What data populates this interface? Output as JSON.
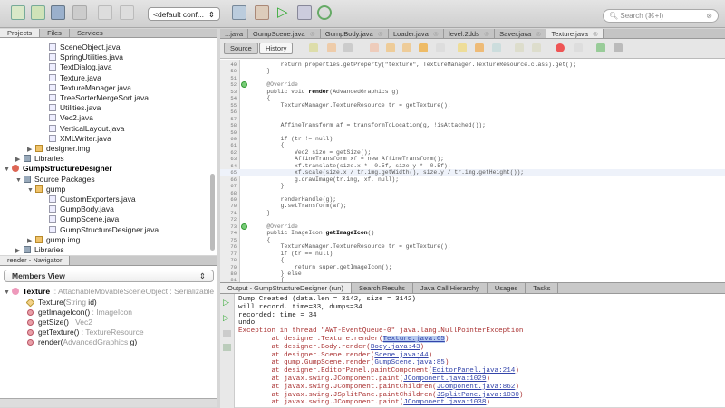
{
  "toolbar": {
    "config": "<default conf...",
    "search_placeholder": "Search (⌘+I)"
  },
  "projects": {
    "tabs": [
      "Projects",
      "Files",
      "Services"
    ],
    "items": [
      {
        "label": "SceneObject.java",
        "type": "java",
        "level": 4
      },
      {
        "label": "SpringUtilities.java",
        "type": "java",
        "level": 4
      },
      {
        "label": "TextDialog.java",
        "type": "java",
        "level": 4
      },
      {
        "label": "Texture.java",
        "type": "java",
        "level": 4
      },
      {
        "label": "TextureManager.java",
        "type": "java",
        "level": 4
      },
      {
        "label": "TreeSorterMergeSort.java",
        "type": "java",
        "level": 4
      },
      {
        "label": "Utilities.java",
        "type": "java",
        "level": 4
      },
      {
        "label": "Vec2.java",
        "type": "java",
        "level": 4
      },
      {
        "label": "VerticalLayout.java",
        "type": "java",
        "level": 4
      },
      {
        "label": "XMLWriter.java",
        "type": "java",
        "level": 4
      },
      {
        "label": "designer.img",
        "type": "pkg",
        "level": 2,
        "arrow": "▶"
      },
      {
        "label": "Libraries",
        "type": "lib",
        "level": 1,
        "arrow": "▶"
      },
      {
        "label": "GumpStructureDesigner",
        "type": "proj",
        "level": 0,
        "arrow": "▼",
        "bold": true
      },
      {
        "label": "Source Packages",
        "type": "lib",
        "level": 1,
        "arrow": "▼"
      },
      {
        "label": "gump",
        "type": "pkg",
        "level": 2,
        "arrow": "▼"
      },
      {
        "label": "CustomExporters.java",
        "type": "java",
        "level": 4
      },
      {
        "label": "GumpBody.java",
        "type": "java",
        "level": 4
      },
      {
        "label": "GumpScene.java",
        "type": "java",
        "level": 4
      },
      {
        "label": "GumpStructureDesigner.java",
        "type": "java",
        "level": 4
      },
      {
        "label": "gump.img",
        "type": "pkg",
        "level": 2,
        "arrow": "▶"
      },
      {
        "label": "Libraries",
        "type": "lib",
        "level": 1,
        "arrow": "▶"
      }
    ]
  },
  "navigator": {
    "title": "render - Navigator",
    "view": "Members View",
    "class_name": "Texture",
    "class_sig": " :: AttachableMovableSceneObject : Serializable",
    "members": [
      {
        "name": "Texture(",
        "args": "String",
        "tail": " id)",
        "ret": ""
      },
      {
        "name": "getImageIcon()",
        "args": "",
        "tail": "",
        "ret": " : ImageIcon"
      },
      {
        "name": "getSize()",
        "args": "",
        "tail": "",
        "ret": " : Vec2"
      },
      {
        "name": "getTexture()",
        "args": "",
        "tail": "",
        "ret": " : TextureResource"
      },
      {
        "name": "render(",
        "args": "AdvancedGraphics",
        "tail": " g)",
        "ret": ""
      }
    ]
  },
  "editor": {
    "tabs": [
      "...java",
      "GumpScene.java",
      "GumpBody.java",
      "Loader.java",
      "level.2dds",
      "Saver.java",
      "Texture.java"
    ],
    "active_tab": "Texture.java",
    "source_label": "Source",
    "history_label": "History",
    "highlight_line": 65,
    "lines": [
      {
        "n": "49",
        "t": "        return properties.getProperty(\"texture\", TextureManager.TextureResource.class).get();"
      },
      {
        "n": "50",
        "t": "    }"
      },
      {
        "n": "51",
        "t": ""
      },
      {
        "n": "52",
        "t": "    @Override"
      },
      {
        "n": "53",
        "t": "    public void ",
        "b": "render",
        "a": "(AdvancedGraphics g)"
      },
      {
        "n": "54",
        "t": "    {"
      },
      {
        "n": "55",
        "t": "        TextureManager.TextureResource tr = getTexture();"
      },
      {
        "n": "56",
        "t": ""
      },
      {
        "n": "57",
        "t": ""
      },
      {
        "n": "58",
        "t": "        AffineTransform af = transformToLocation(g, !isAttached());"
      },
      {
        "n": "59",
        "t": ""
      },
      {
        "n": "60",
        "t": "        if (tr != null)"
      },
      {
        "n": "61",
        "t": "        {"
      },
      {
        "n": "62",
        "t": "            Vec2 size = getSize();"
      },
      {
        "n": "63",
        "t": "            AffineTransform xf = new AffineTransform();"
      },
      {
        "n": "64",
        "t": "            xf.translate(size.x * -0.5f, size.y * -0.5f);"
      },
      {
        "n": "65",
        "t": "            xf.scale(size.x / tr.img.getWidth(), size.y / tr.img.getHeight());"
      },
      {
        "n": "66",
        "t": "            g.drawImage(tr.img, xf, null);"
      },
      {
        "n": "67",
        "t": "        }"
      },
      {
        "n": "68",
        "t": ""
      },
      {
        "n": "69",
        "t": "        renderHandle(g);"
      },
      {
        "n": "70",
        "t": "        g.setTransform(af);"
      },
      {
        "n": "71",
        "t": "    }"
      },
      {
        "n": "72",
        "t": ""
      },
      {
        "n": "73",
        "t": "    @Override"
      },
      {
        "n": "74",
        "t": "    public ImageIcon ",
        "b": "getImageIcon",
        "a": "()"
      },
      {
        "n": "75",
        "t": "    {"
      },
      {
        "n": "76",
        "t": "        TextureManager.TextureResource tr = getTexture();"
      },
      {
        "n": "77",
        "t": "        if (tr == null)"
      },
      {
        "n": "78",
        "t": "        {"
      },
      {
        "n": "79",
        "t": "            return super.getImageIcon();"
      },
      {
        "n": "80",
        "t": "        } else"
      },
      {
        "n": "81",
        "t": "        {"
      }
    ]
  },
  "output": {
    "tabs": [
      "Output - GumpStructureDesigner (run)",
      "Search Results",
      "Java Call Hierarchy",
      "Usages",
      "Tasks"
    ],
    "lines": [
      {
        "t": "Dump Created (data.len = 3142, size = 3142)"
      },
      {
        "t": "will record. time=33, dumps=34"
      },
      {
        "t": "recorded: time = 34"
      },
      {
        "t": "undo"
      },
      {
        "t": "Exception in thread \"AWT-EventQueue-0\" java.lang.NullPointerException",
        "err": true
      },
      {
        "t": "        at designer.Texture.render(",
        "l": "Texture.java:65",
        "a": ")",
        "err": true,
        "sel": true
      },
      {
        "t": "        at designer.Body.render(",
        "l": "Body.java:43",
        "a": ")",
        "err": true
      },
      {
        "t": "        at designer.Scene.render(",
        "l": "Scene.java:44",
        "a": ")",
        "err": true
      },
      {
        "t": "        at gump.GumpScene.render(",
        "l": "GumpScene.java:85",
        "a": ")",
        "err": true
      },
      {
        "t": "        at designer.EditorPanel.paintComponent(",
        "l": "EditorPanel.java:214",
        "a": ")",
        "err": true
      },
      {
        "t": "        at javax.swing.JComponent.paint(",
        "l": "JComponent.java:1029",
        "a": ")",
        "err": true
      },
      {
        "t": "        at javax.swing.JComponent.paintChildren(",
        "l": "JComponent.java:862",
        "a": ")",
        "err": true
      },
      {
        "t": "        at javax.swing.JSplitPane.paintChildren(",
        "l": "JSplitPane.java:1030",
        "a": ")",
        "err": true
      },
      {
        "t": "        at javax.swing.JComponent.paint(",
        "l": "JComponent.java:1038",
        "a": ")",
        "err": true
      }
    ]
  }
}
